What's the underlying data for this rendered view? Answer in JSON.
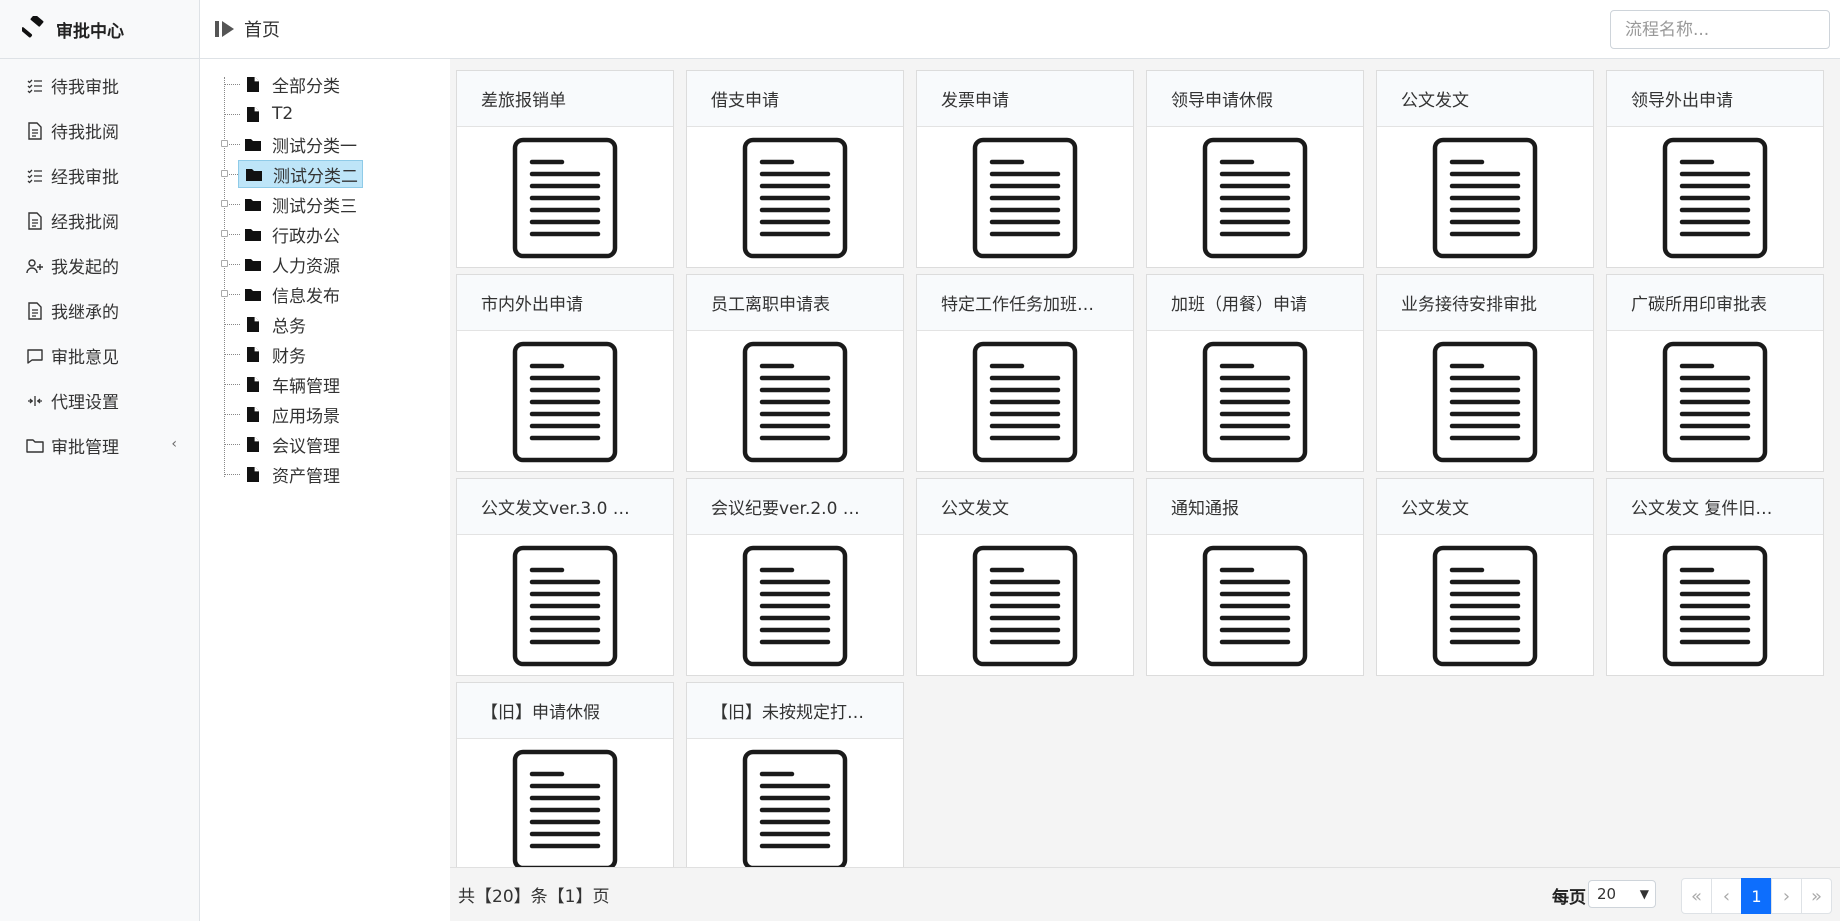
{
  "sidebar": {
    "brand_title": "审批中心",
    "items": [
      {
        "label": "待我审批",
        "icon": "checklist-icon"
      },
      {
        "label": "待我批阅",
        "icon": "document-icon"
      },
      {
        "label": "经我审批",
        "icon": "checklist-icon"
      },
      {
        "label": "经我批阅",
        "icon": "document-icon"
      },
      {
        "label": "我发起的",
        "icon": "user-plus-icon"
      },
      {
        "label": "我继承的",
        "icon": "document-icon"
      },
      {
        "label": "审批意见",
        "icon": "chat-icon"
      },
      {
        "label": "代理设置",
        "icon": "arrows-collapse-icon"
      },
      {
        "label": "审批管理",
        "icon": "folder-icon"
      }
    ]
  },
  "header": {
    "breadcrumb": "首页",
    "search_placeholder": "流程名称..."
  },
  "tree": {
    "items": [
      {
        "label": "全部分类",
        "icon": "file-icon"
      },
      {
        "label": "T2",
        "icon": "file-icon"
      },
      {
        "label": "测试分类一",
        "icon": "folder-icon"
      },
      {
        "label": "测试分类二",
        "icon": "folder-icon"
      },
      {
        "label": "测试分类三",
        "icon": "folder-icon"
      },
      {
        "label": "行政办公",
        "icon": "folder-icon"
      },
      {
        "label": "人力资源",
        "icon": "folder-icon"
      },
      {
        "label": "信息发布",
        "icon": "folder-icon"
      },
      {
        "label": "总务",
        "icon": "file-icon"
      },
      {
        "label": "财务",
        "icon": "file-icon"
      },
      {
        "label": "车辆管理",
        "icon": "file-icon"
      },
      {
        "label": "应用场景",
        "icon": "file-icon"
      },
      {
        "label": "会议管理",
        "icon": "file-icon"
      },
      {
        "label": "资产管理",
        "icon": "file-icon"
      }
    ],
    "selected": "测试分类二"
  },
  "cards": [
    "差旅报销单",
    "借支申请",
    "发票申请",
    "领导申请休假",
    "公文发文",
    "领导外出申请",
    "市内外出申请",
    "员工离职申请表",
    "特定工作任务加班…",
    "加班（用餐）申请",
    "业务接待安排审批",
    "广碳所用印审批表",
    "公文发文ver.3.0 …",
    "会议纪要ver.2.0 …",
    "公文发文",
    "通知通报",
    "公文发文",
    "公文发文 复件旧…",
    "【旧】申请休假",
    "【旧】未按规定打…"
  ],
  "footer": {
    "total_text": "共【20】条【1】页",
    "per_page_label": "每页",
    "per_page_value": "20",
    "pager": {
      "first": "«",
      "prev": "‹",
      "current": "1",
      "next": "›",
      "last": "»"
    }
  }
}
